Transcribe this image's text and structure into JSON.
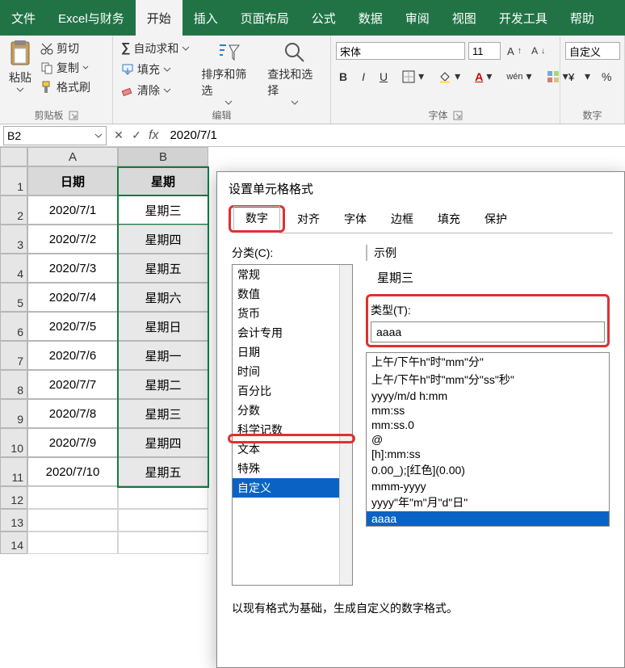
{
  "tabs": {
    "file": "文件",
    "custom": "Excel与财务",
    "home": "开始",
    "insert": "插入",
    "layout": "页面布局",
    "formulas": "公式",
    "data": "数据",
    "review": "审阅",
    "view": "视图",
    "developer": "开发工具",
    "help": "帮助"
  },
  "ribbon": {
    "clipboard": {
      "paste": "粘贴",
      "cut": "剪切",
      "copy": "复制",
      "format_painter": "格式刷",
      "group": "剪贴板"
    },
    "edit": {
      "autosum": "自动求和",
      "fill": "填充",
      "clear": "清除",
      "sort_filter": "排序和筛选",
      "find_select": "查找和选择",
      "group": "编辑"
    },
    "font": {
      "name_value": "宋体",
      "size_value": "11",
      "bold": "B",
      "italic": "I",
      "underline": "U",
      "wen": "wén",
      "group": "字体"
    },
    "number": {
      "format_value": "自定义",
      "group": "数字"
    }
  },
  "fbar": {
    "namebox": "B2",
    "cancel": "✕",
    "confirm": "✓",
    "fx": "fx",
    "formula": "2020/7/1"
  },
  "grid": {
    "colA": "A",
    "colB": "B",
    "headers": {
      "date": "日期",
      "week": "星期"
    },
    "rows": [
      {
        "a": "2020/7/1",
        "b": "星期三"
      },
      {
        "a": "2020/7/2",
        "b": "星期四"
      },
      {
        "a": "2020/7/3",
        "b": "星期五"
      },
      {
        "a": "2020/7/4",
        "b": "星期六"
      },
      {
        "a": "2020/7/5",
        "b": "星期日"
      },
      {
        "a": "2020/7/6",
        "b": "星期一"
      },
      {
        "a": "2020/7/7",
        "b": "星期二"
      },
      {
        "a": "2020/7/8",
        "b": "星期三"
      },
      {
        "a": "2020/7/9",
        "b": "星期四"
      },
      {
        "a": "2020/7/10",
        "b": "星期五"
      }
    ],
    "row_labels": [
      "1",
      "2",
      "3",
      "4",
      "5",
      "6",
      "7",
      "8",
      "9",
      "10",
      "11",
      "12",
      "13",
      "14"
    ]
  },
  "dialog": {
    "title": "设置单元格格式",
    "tabs": {
      "number": "数字",
      "align": "对齐",
      "font": "字体",
      "border": "边框",
      "fill": "填充",
      "protect": "保护"
    },
    "category_label": "分类(C):",
    "categories": [
      "常规",
      "数值",
      "货币",
      "会计专用",
      "日期",
      "时间",
      "百分比",
      "分数",
      "科学记数",
      "文本",
      "特殊",
      "自定义"
    ],
    "sample_label": "示例",
    "sample_value": "星期三",
    "type_label": "类型(T):",
    "type_value": "aaaa",
    "formats": [
      "上午/下午h\"时\"mm\"分\"",
      "上午/下午h\"时\"mm\"分\"ss\"秒\"",
      "yyyy/m/d h:mm",
      "mm:ss",
      "mm:ss.0",
      "@",
      "[h]:mm:ss",
      "0.00_);[红色](0.00)",
      "mmm-yyyy",
      "yyyy\"年\"m\"月\"d\"日\"",
      "aaaa"
    ],
    "footer": "以现有格式为基础，生成自定义的数字格式。"
  }
}
